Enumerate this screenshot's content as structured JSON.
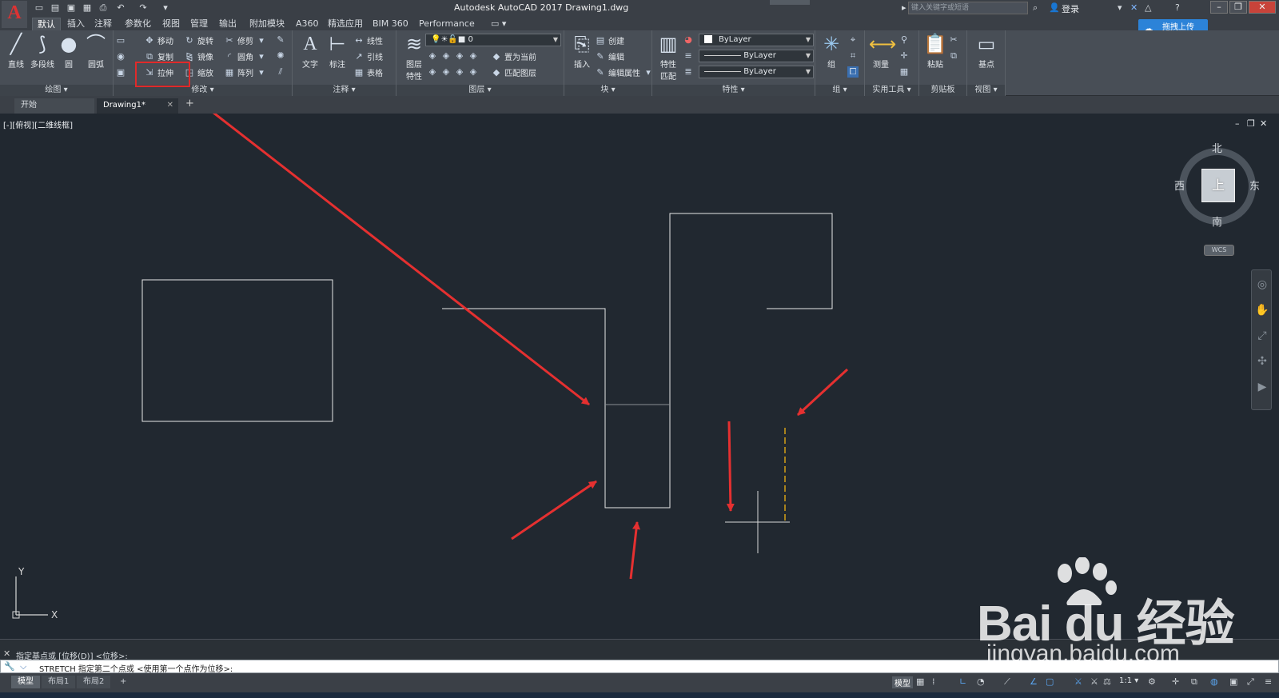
{
  "titlebar": {
    "title": "Autodesk AutoCAD 2017    Drawing1.dwg",
    "search_placeholder": "键入关键字或短语",
    "login": "登录"
  },
  "ribbon_tabs": [
    "默认",
    "插入",
    "注释",
    "参数化",
    "视图",
    "管理",
    "输出",
    "附加模块",
    "A360",
    "精选应用",
    "BIM 360",
    "Performance"
  ],
  "upload_button": "拖拽上传",
  "ribbon": {
    "draw": {
      "title": "绘图 ▾",
      "line": "直线",
      "polyline": "多段线",
      "circle": "圆",
      "arc": "圆弧"
    },
    "modify": {
      "title": "修改 ▾",
      "move": "移动",
      "rotate": "旋转",
      "trim": "修剪",
      "copy": "复制",
      "mirror": "镜像",
      "fillet": "圆角",
      "stretch": "拉伸",
      "scale": "缩放",
      "array": "阵列"
    },
    "annotation": {
      "title": "注释 ▾",
      "text": "文字",
      "dimension": "标注",
      "linear": "线性",
      "leader": "引线",
      "table": "表格"
    },
    "layers": {
      "title": "图层 ▾",
      "layer_properties": "图层\n特性",
      "current_layer": "0",
      "make_current": "置为当前",
      "match_layer": "匹配图层"
    },
    "block": {
      "title": "块 ▾",
      "insert": "插入",
      "create": "创建",
      "edit": "编辑",
      "edit_attributes": "编辑属性"
    },
    "properties": {
      "title": "特性 ▾",
      "match": "特性\n匹配",
      "color": "ByLayer",
      "linetype": "ByLayer",
      "lineweight": "ByLayer"
    },
    "groups": {
      "title": "组 ▾",
      "group": "组"
    },
    "utilities": {
      "title": "实用工具 ▾",
      "measure": "测量"
    },
    "clipboard": {
      "title": "剪贴板",
      "paste": "粘贴"
    },
    "view": {
      "title": "视图 ▾",
      "base": "基点"
    }
  },
  "file_tabs": {
    "start": "开始",
    "drawing": "Drawing1*"
  },
  "viewport": {
    "label": "[-][俯视][二维线框]",
    "compass": {
      "north": "北",
      "south": "南",
      "east": "东",
      "west": "西",
      "face": "上"
    },
    "wcs": "WCS",
    "ucs_x": "X",
    "ucs_y": "Y"
  },
  "watermark": {
    "brand": "Bai du 经验",
    "site": "jingyan.baidu.com"
  },
  "command": {
    "history": "指定基点或 [位移(D)] <位移>:",
    "prompt": "STRETCH 指定第二个点或 <使用第一个点作为位移>:"
  },
  "layout_tabs": [
    "模型",
    "布局1",
    "布局2"
  ],
  "status": {
    "model": "模型",
    "scale": "1:1 ▾"
  },
  "colors": {
    "canvas": "#212830",
    "geometry": "#e8e8e8",
    "rubberband": "#d4a017",
    "annotation_arrow": "#e53030",
    "ribbon": "#484e56",
    "accent": "#2c83d8"
  }
}
